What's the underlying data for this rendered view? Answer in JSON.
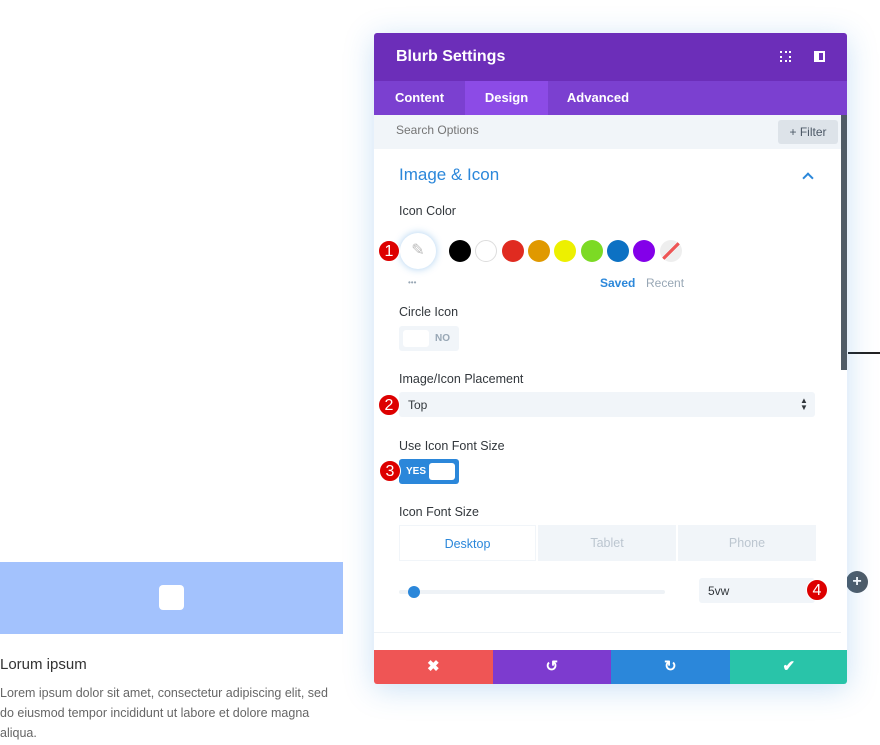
{
  "panel": {
    "title": "Blurb Settings",
    "tabs": [
      "Content",
      "Design",
      "Advanced"
    ],
    "active_tab": "Design",
    "search_placeholder": "Search Options",
    "filter_label": "+ Filter",
    "section_title": "Image & Icon",
    "icon_color": {
      "label": "Icon Color",
      "swatches": [
        "#000000",
        "#ffffff",
        "#e02b20",
        "#e09900",
        "#edf000",
        "#7cda24",
        "#0c71c3",
        "#8300e9",
        "none"
      ],
      "saved": "Saved",
      "recent": "Recent",
      "more": "•••"
    },
    "circle_icon": {
      "label": "Circle Icon",
      "value": "NO"
    },
    "placement": {
      "label": "Image/Icon Placement",
      "value": "Top"
    },
    "use_font_size": {
      "label": "Use Icon Font Size",
      "value": "YES"
    },
    "font_size": {
      "label": "Icon Font Size",
      "devices": [
        "Desktop",
        "Tablet",
        "Phone"
      ],
      "active_device": "Desktop",
      "value": "5vw"
    },
    "badges": [
      "1",
      "2",
      "3",
      "4"
    ],
    "footer": {
      "cancel": "✖",
      "undo": "↺",
      "redo": "↻",
      "save": "✔"
    }
  },
  "preview": {
    "title": "Lorum ipsum",
    "body": "Lorem ipsum dolor sit amet, consectetur adipiscing elit, sed do eiusmod tempor incididunt ut labore et dolore magna aliqua.",
    "accent": "#a3c2fd"
  }
}
